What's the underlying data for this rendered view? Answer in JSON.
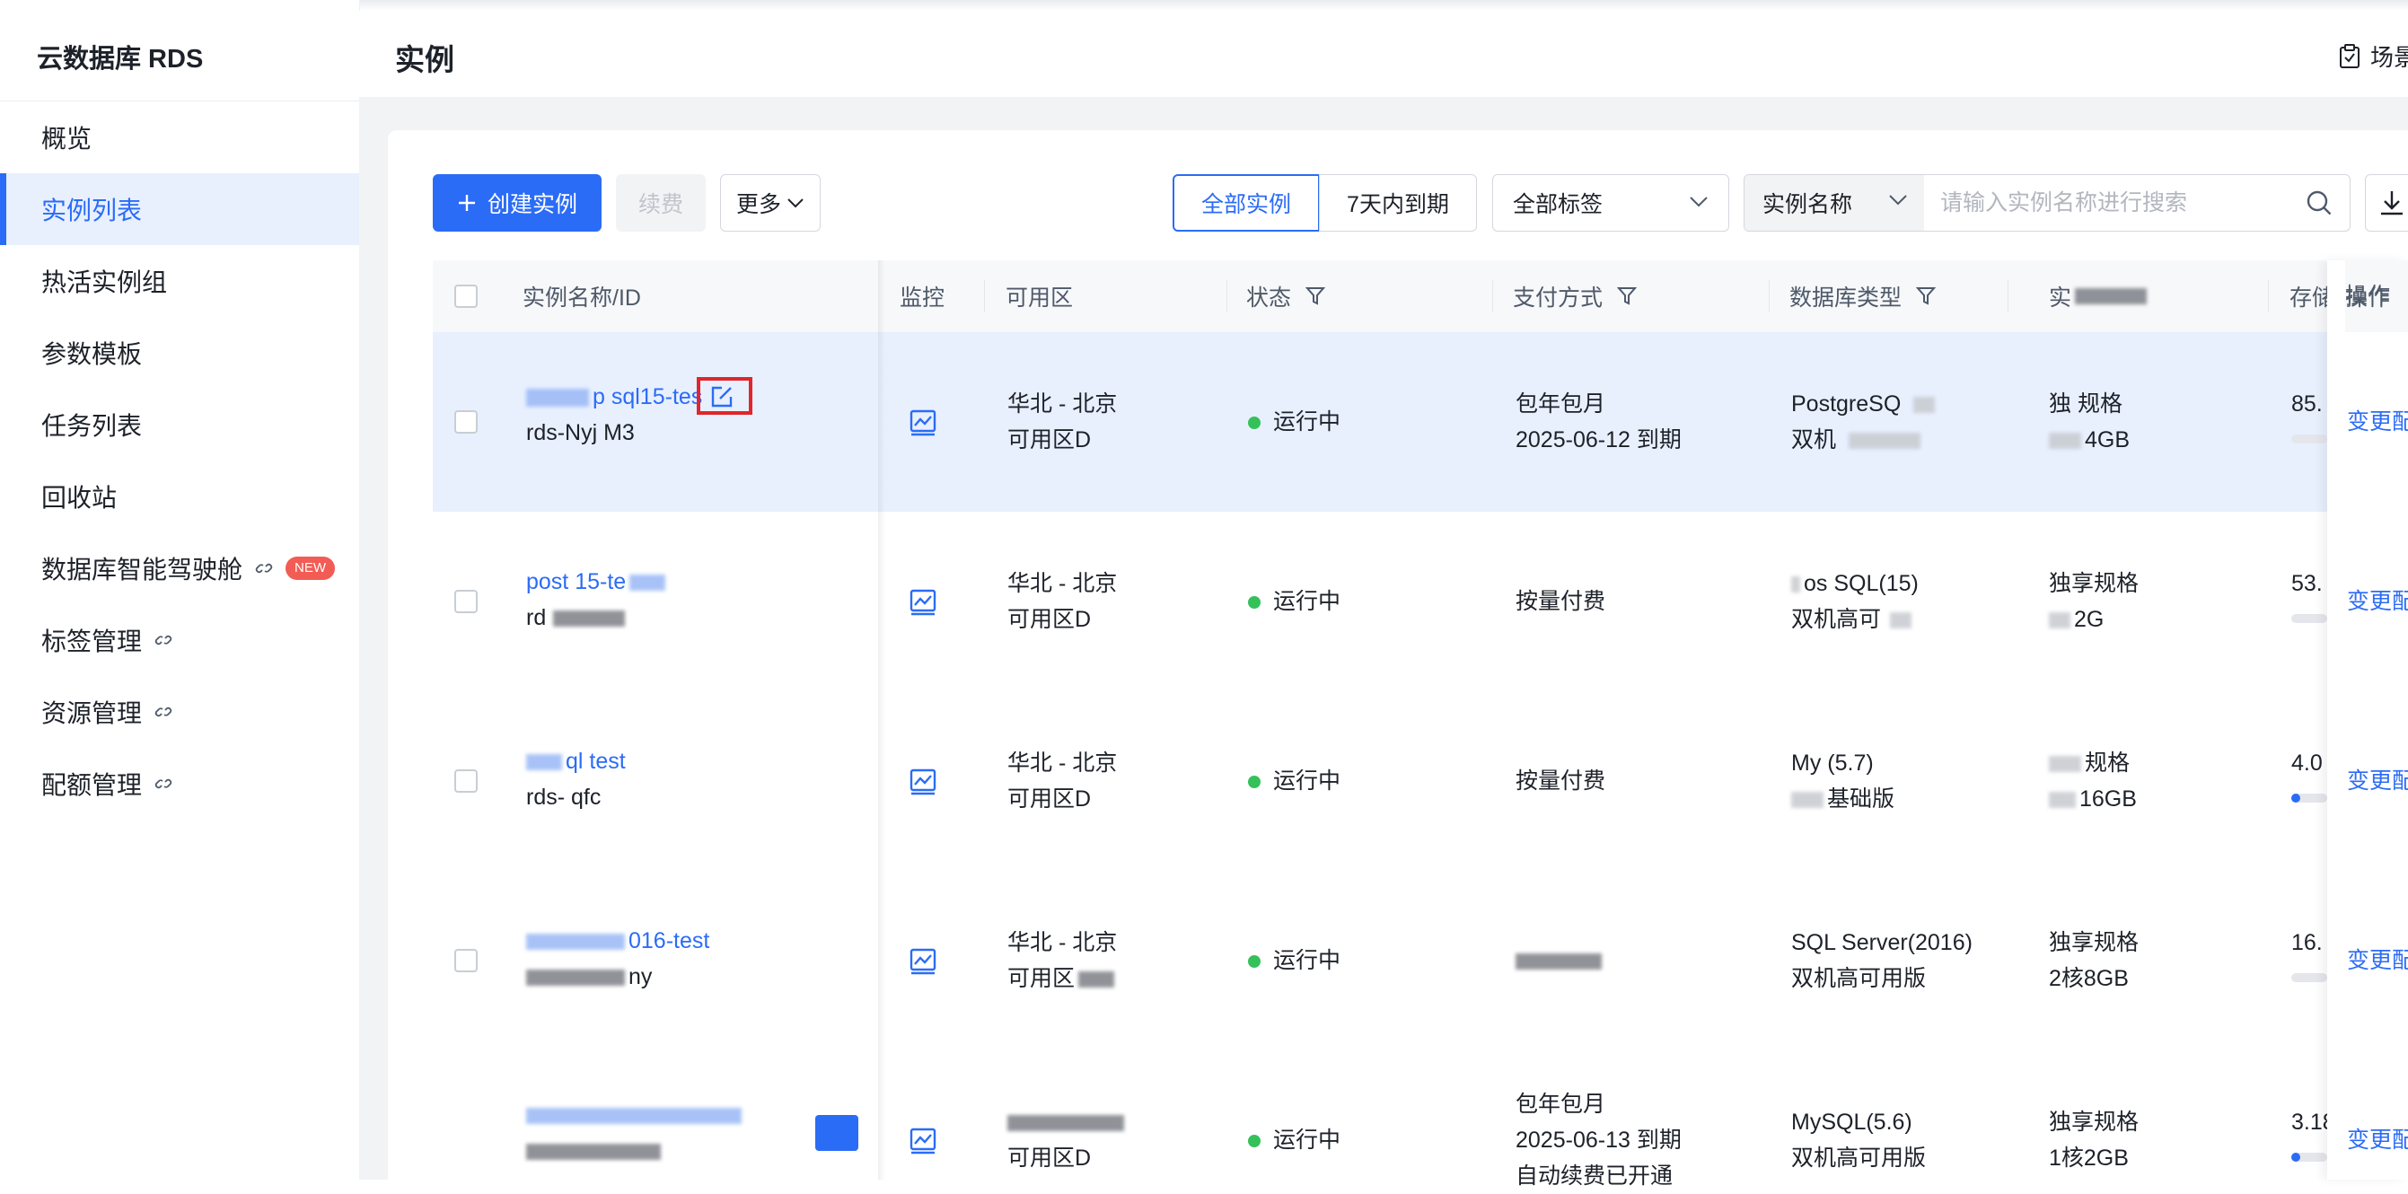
{
  "sidebar": {
    "brand": "云数据库 RDS",
    "items": [
      {
        "label": "概览"
      },
      {
        "label": "实例列表"
      },
      {
        "label": "热活实例组"
      },
      {
        "label": "参数模板"
      },
      {
        "label": "任务列表"
      },
      {
        "label": "回收站"
      },
      {
        "label": "数据库智能驾驶舱",
        "badge": "NEW"
      },
      {
        "label": "标签管理"
      },
      {
        "label": "资源管理"
      },
      {
        "label": "配额管理"
      }
    ]
  },
  "header": {
    "title": "实例",
    "scene_label": "场景"
  },
  "toolbar": {
    "create_label": "创建实例",
    "renew_label": "续费",
    "more_label": "更多",
    "segment_all": "全部实例",
    "segment_expiring": "7天内到期",
    "tag_select": "全部标签",
    "search_type": "实例名称",
    "search_placeholder": "请输入实例名称进行搜索"
  },
  "table": {
    "headers": {
      "name": "实例名称/ID",
      "monitor": "监控",
      "zone": "可用区",
      "status": "状态",
      "payment": "支付方式",
      "dbtype": "数据库类型",
      "spec": "实",
      "storage": "存储",
      "actions": "操作"
    },
    "rows": [
      {
        "name": "p sql15-tes",
        "id": "rds-Nyj M3",
        "zone_l1": "华北 - 北京",
        "zone_l2": "可用区D",
        "status": "运行中",
        "pay_l1": "包年包月",
        "pay_l2": "2025-06-12 到期",
        "db_l1": "PostgreSQ",
        "db_l2": "双机",
        "spec_l1": "独 规格",
        "spec_l2": "4GB",
        "storage": "85.",
        "action": "变更配"
      },
      {
        "name": "post 15-te",
        "id": "rd",
        "zone_l1": "华北 - 北京",
        "zone_l2": "可用区D",
        "status": "运行中",
        "pay_l1": "按量付费",
        "pay_l2": "",
        "db_l1": "os SQL(15)",
        "db_l2": "双机高可",
        "spec_l1": "独享规格",
        "spec_l2": "2G",
        "storage": "53.",
        "action": "变更配"
      },
      {
        "name": "ql test",
        "id": "rds- qfc",
        "zone_l1": "华北 - 北京",
        "zone_l2": "可用区D",
        "status": "运行中",
        "pay_l1": "按量付费",
        "pay_l2": "",
        "db_l1": "My (5.7)",
        "db_l2": "基础版",
        "spec_l1": "规格",
        "spec_l2": "16GB",
        "storage": "4.0",
        "action": "变更配"
      },
      {
        "name": "016-test",
        "id": "ny",
        "zone_l1": "华北 - 北京",
        "zone_l2": "可用区",
        "status": "运行中",
        "pay_l1": "",
        "pay_l2": "",
        "db_l1": "SQL Server(2016)",
        "db_l2": "双机高可用版",
        "spec_l1": "独享规格",
        "spec_l2": "2核8GB",
        "storage": "16.",
        "action": "变更配"
      },
      {
        "name": "",
        "id": "",
        "zone_l1": "",
        "zone_l2": "可用区D",
        "status": "运行中",
        "pay_l1": "包年包月",
        "pay_l2": "2025-06-13 到期",
        "pay_l3": "自动续费已开通",
        "db_l1": "MySQL(5.6)",
        "db_l2": "双机高可用版",
        "spec_l1": "独享规格",
        "spec_l2": "1核2GB",
        "storage": "3.18",
        "action": "变更配"
      }
    ]
  },
  "colors": {
    "accent": "#2b6cf6",
    "status_running": "#35c15a",
    "new_badge": "#f25c54",
    "highlight_box": "#e0262b"
  }
}
